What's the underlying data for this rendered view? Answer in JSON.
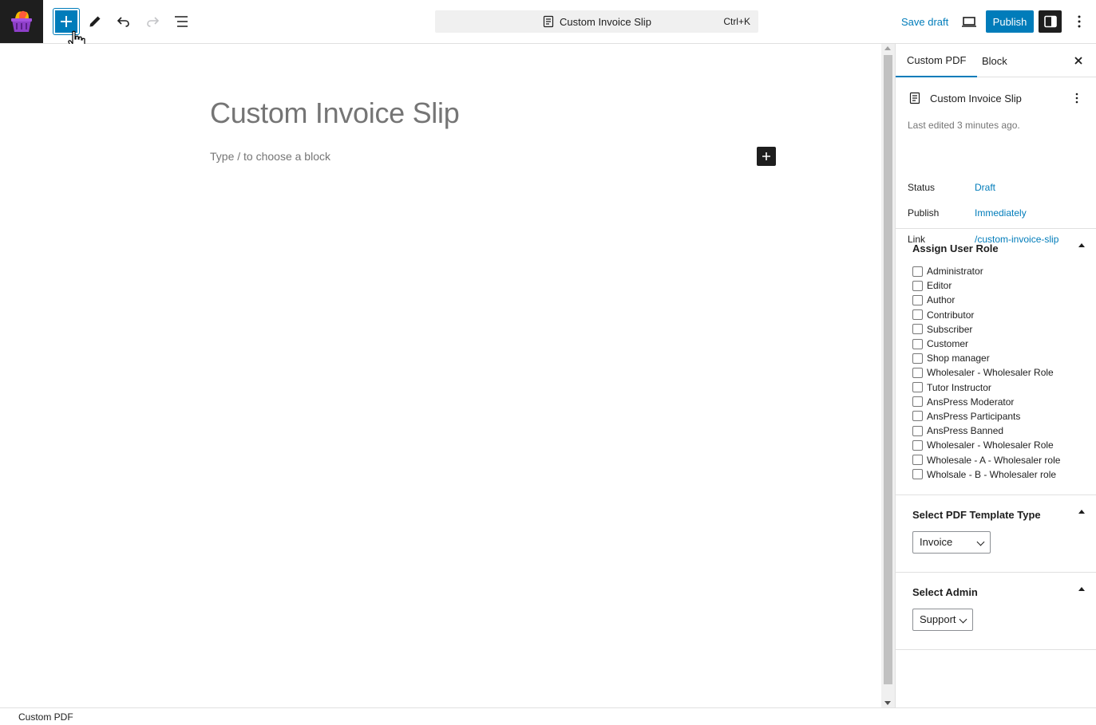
{
  "toolbar": {
    "logo_icon": "shopping-basket-icon",
    "inserter_icon": "plus-icon",
    "tools_icon": "pencil-icon",
    "undo_icon": "undo-icon",
    "redo_icon": "redo-icon",
    "list_view_icon": "list-view-icon",
    "command_title": "Custom Invoice Slip",
    "command_shortcut": "Ctrl+K",
    "save_draft_label": "Save draft",
    "preview_icon": "desktop-icon",
    "publish_label": "Publish",
    "settings_icon": "sidebar-toggle-icon",
    "options_icon": "more-vertical-icon",
    "accent_color": "#007cba"
  },
  "editor": {
    "title": "Custom Invoice Slip",
    "block_placeholder": "Type / to choose a block"
  },
  "sidebar": {
    "tabs": [
      {
        "label": "Custom PDF",
        "active": true
      },
      {
        "label": "Block",
        "active": false
      }
    ],
    "post_title": "Custom Invoice Slip",
    "last_edited": "Last edited 3 minutes ago.",
    "status_label": "Status",
    "status_value": "Draft",
    "publish_label": "Publish",
    "publish_value": "Immediately",
    "link_label": "Link",
    "link_value": "/custom-invoice-slip",
    "roles_panel": {
      "title": "Assign User Role",
      "roles": [
        "Administrator",
        "Editor",
        "Author",
        "Contributor",
        "Subscriber",
        "Customer",
        "Shop manager",
        "Wholesaler - Wholesaler Role",
        "Tutor Instructor",
        "AnsPress Moderator",
        "AnsPress Participants",
        "AnsPress Banned",
        "Wholesaler - Wholesaler Role",
        "Wholesale - A - Wholesaler role",
        "Wholsale - B - Wholesaler role"
      ]
    },
    "template_panel": {
      "title": "Select PDF Template Type",
      "selected": "Invoice"
    },
    "admin_panel": {
      "title": "Select Admin",
      "selected": "Support"
    }
  },
  "footer": {
    "breadcrumb": "Custom PDF"
  }
}
